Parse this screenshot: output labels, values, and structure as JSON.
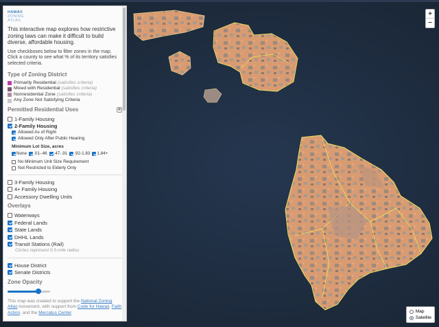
{
  "logo": {
    "line1": "HAWAII",
    "line2": "ZONING",
    "line3": "ATLAS"
  },
  "intro": "This interactive map explores how restrictive zoning laws can make it difficult to build diverse, affordable housing.",
  "help": "Use checkboxes below to filter zones in the map. Click a county to see what % of its territory satisfies selected criteria.",
  "zoning_type": {
    "title": "Type of Zoning District",
    "items": [
      {
        "label": "Primarily Residential",
        "crit": "(satisfies criteria)",
        "color": "#c03aa8"
      },
      {
        "label": "Mixed with Residential",
        "crit": "(satisfies criteria)",
        "color": "#7a5a6e"
      },
      {
        "label": "Nonresidential Zone",
        "crit": "(satisfies criteria)",
        "color": "#b08aa8"
      },
      {
        "label": "Any Zone Not Satisfying Criteria",
        "crit": "",
        "color": "#c8c8c8"
      }
    ]
  },
  "uses": {
    "title": "Permitted Residential Uses",
    "one_family": "1-Family Housing",
    "two_family": "2-Family Housing",
    "allowed_right": "Allowed As of Right",
    "allowed_hearing": "Allowed Only After Public Hearing",
    "lot_title": "Minimum Lot Size, acres",
    "lot_sizes": [
      "None",
      ".01-.46",
      ".47-.91",
      ".92-1.83",
      "1.84+"
    ],
    "no_min_unit": "No Minimum Unit Size Requirement",
    "not_restricted": "Not Restricted to Elderly Only",
    "three_family": "3-Family Housing",
    "four_family": "4+ Family Housing",
    "adu": "Accessory Dwelling Units"
  },
  "overlays": {
    "title": "Overlays",
    "items": [
      {
        "label": "Waterways",
        "checked": false
      },
      {
        "label": "Federal Lands",
        "checked": true
      },
      {
        "label": "State Lands",
        "checked": true
      },
      {
        "label": "DHHL Lands",
        "checked": true
      },
      {
        "label": "Transit Stations (Rail)",
        "checked": true
      }
    ],
    "note": "Circles represent 0.5-mile radius",
    "house": "House District",
    "senate": "Senate Districts"
  },
  "opacity": {
    "title": "Zone Opacity",
    "value": 0.72
  },
  "footer": {
    "t1": "This map was created to support the ",
    "l1": "National Zoning Atlas",
    "t2": " movement, with support from ",
    "l2": "Code for Hawaii",
    "t3": ", ",
    "l3": "Faith Action",
    "t4": ", and the ",
    "l4": "Mercatus Center",
    "t5": "."
  },
  "zoom": {
    "in": "+",
    "out": "−"
  },
  "basemap": {
    "map": "Map",
    "satellite": "Satellite",
    "selected": "Satellite"
  },
  "colors": {
    "accent": "#1a73c8",
    "zone_fill": "#d99a6c",
    "ocean": "#1d2a3c",
    "district_line": "#f2e35a"
  }
}
